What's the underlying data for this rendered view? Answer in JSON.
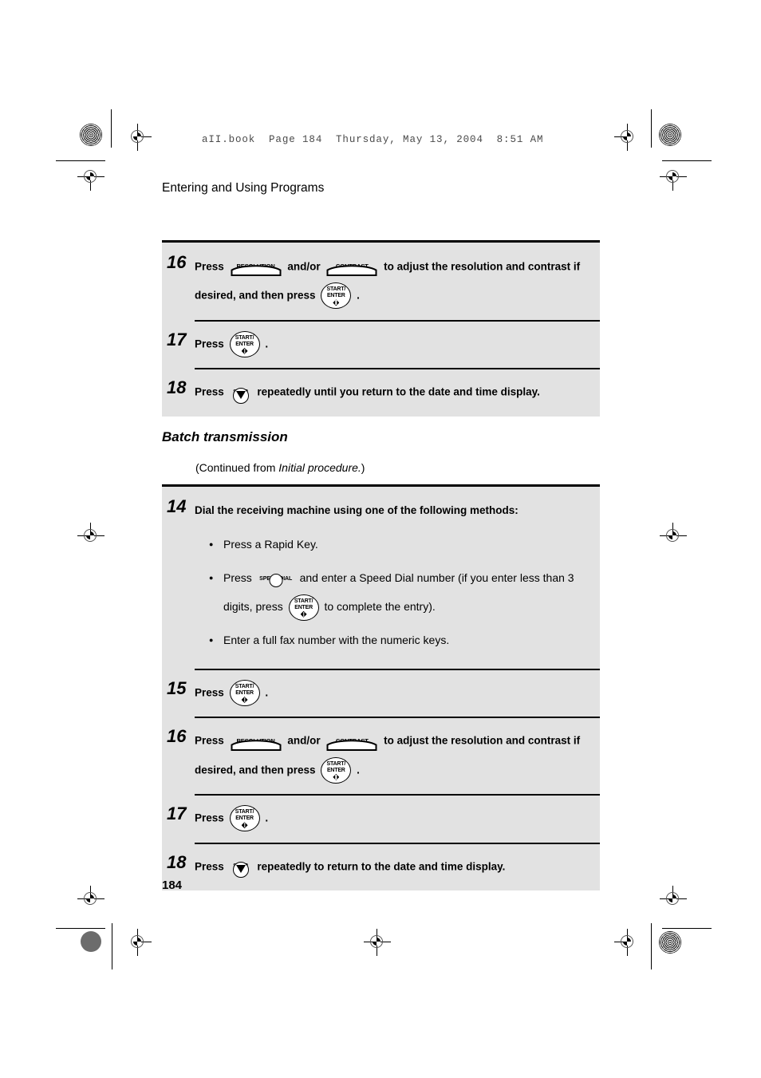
{
  "header": {
    "file_line": "aII.book  Page 184  Thursday, May 13, 2004  8:51 AM",
    "chapter_title": "Entering and Using Programs"
  },
  "page_number": "184",
  "section": {
    "heading": "Batch transmission",
    "continued_prefix": "(Continued from ",
    "continued_italic": "Initial procedure.",
    "continued_suffix": ")"
  },
  "keys": {
    "start_enter": {
      "line1": "START/",
      "line2": "ENTER",
      "name": "start-enter-key"
    },
    "stop": {
      "label": "STOP",
      "name": "stop-key"
    },
    "speed_dial": {
      "label": "SPEED DIAL",
      "name": "speed-dial-key"
    },
    "resolution": {
      "label": "RESOLUTION",
      "name": "resolution-key"
    },
    "contrast": {
      "label": "CONTRAST",
      "name": "contrast-key"
    }
  },
  "table_one": {
    "steps": [
      {
        "number": "16",
        "text_a": "Press",
        "text_b": "and/or",
        "text_c": "to adjust the resolution and contrast if",
        "text_d": "desired, and then press",
        "text_e": "."
      },
      {
        "number": "17",
        "text_a": "Press",
        "text_b": "."
      },
      {
        "number": "18",
        "text_a": "Press",
        "text_b": "repeatedly until you return to the date and time display."
      }
    ]
  },
  "table_two": {
    "steps": [
      {
        "number": "14",
        "title": "Dial the receiving machine using one of the following methods:",
        "bullets": [
          {
            "text_a": "Press a Rapid Key."
          },
          {
            "text_a": "Press",
            "text_b": "and enter a Speed Dial number (if you enter less than 3",
            "text_c": "digits, press",
            "text_d": "to complete the entry)."
          },
          {
            "text_a": "Enter a full fax number with the numeric keys."
          }
        ]
      },
      {
        "number": "15",
        "text_a": "Press",
        "text_b": "."
      },
      {
        "number": "16",
        "text_a": "Press",
        "text_b": "and/or",
        "text_c": "to adjust the resolution and contrast if",
        "text_d": "desired, and then press",
        "text_e": "."
      },
      {
        "number": "17",
        "text_a": "Press",
        "text_b": "."
      },
      {
        "number": "18",
        "text_a": "Press",
        "text_b": "repeatedly to return to the date and time display."
      }
    ]
  },
  "colors": {
    "step_box_bg": "#e2e2e2",
    "rule": "#000000",
    "page_bg": "#ffffff"
  }
}
